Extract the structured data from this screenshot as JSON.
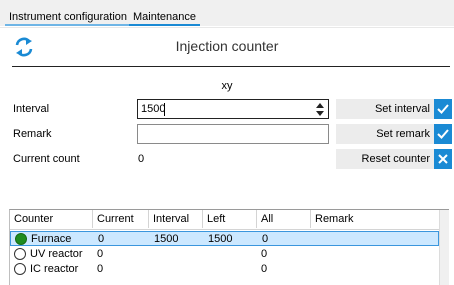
{
  "tabs": [
    {
      "label": "Instrument configuration",
      "active": false
    },
    {
      "label": "Maintenance",
      "active": true
    }
  ],
  "panel": {
    "title": "Injection counter",
    "subtitle": "xy"
  },
  "form": {
    "interval_label": "Interval",
    "interval_value": "1500",
    "remark_label": "Remark",
    "remark_value": "",
    "current_count_label": "Current count",
    "current_count_value": "0"
  },
  "buttons": {
    "set_interval": "Set interval",
    "set_remark": "Set remark",
    "reset_counter": "Reset counter"
  },
  "table": {
    "columns": [
      "Counter",
      "Current",
      "Interval",
      "Left",
      "All",
      "Remark"
    ],
    "rows": [
      {
        "counter": "Furnace",
        "current": "0",
        "interval": "1500",
        "left": "1500",
        "all": "0",
        "remark": "",
        "selected": true
      },
      {
        "counter": "UV reactor",
        "current": "0",
        "interval": "",
        "left": "",
        "all": "0",
        "remark": "",
        "selected": false
      },
      {
        "counter": "IC reactor",
        "current": "0",
        "interval": "",
        "left": "",
        "all": "0",
        "remark": "",
        "selected": false
      }
    ]
  },
  "colors": {
    "accent": "#1a8ad4",
    "selected_row": "#cce8ff",
    "active_radio": "#1f8c1f"
  },
  "icons": {
    "refresh": "refresh-icon",
    "check": "check-icon",
    "close": "close-icon"
  }
}
